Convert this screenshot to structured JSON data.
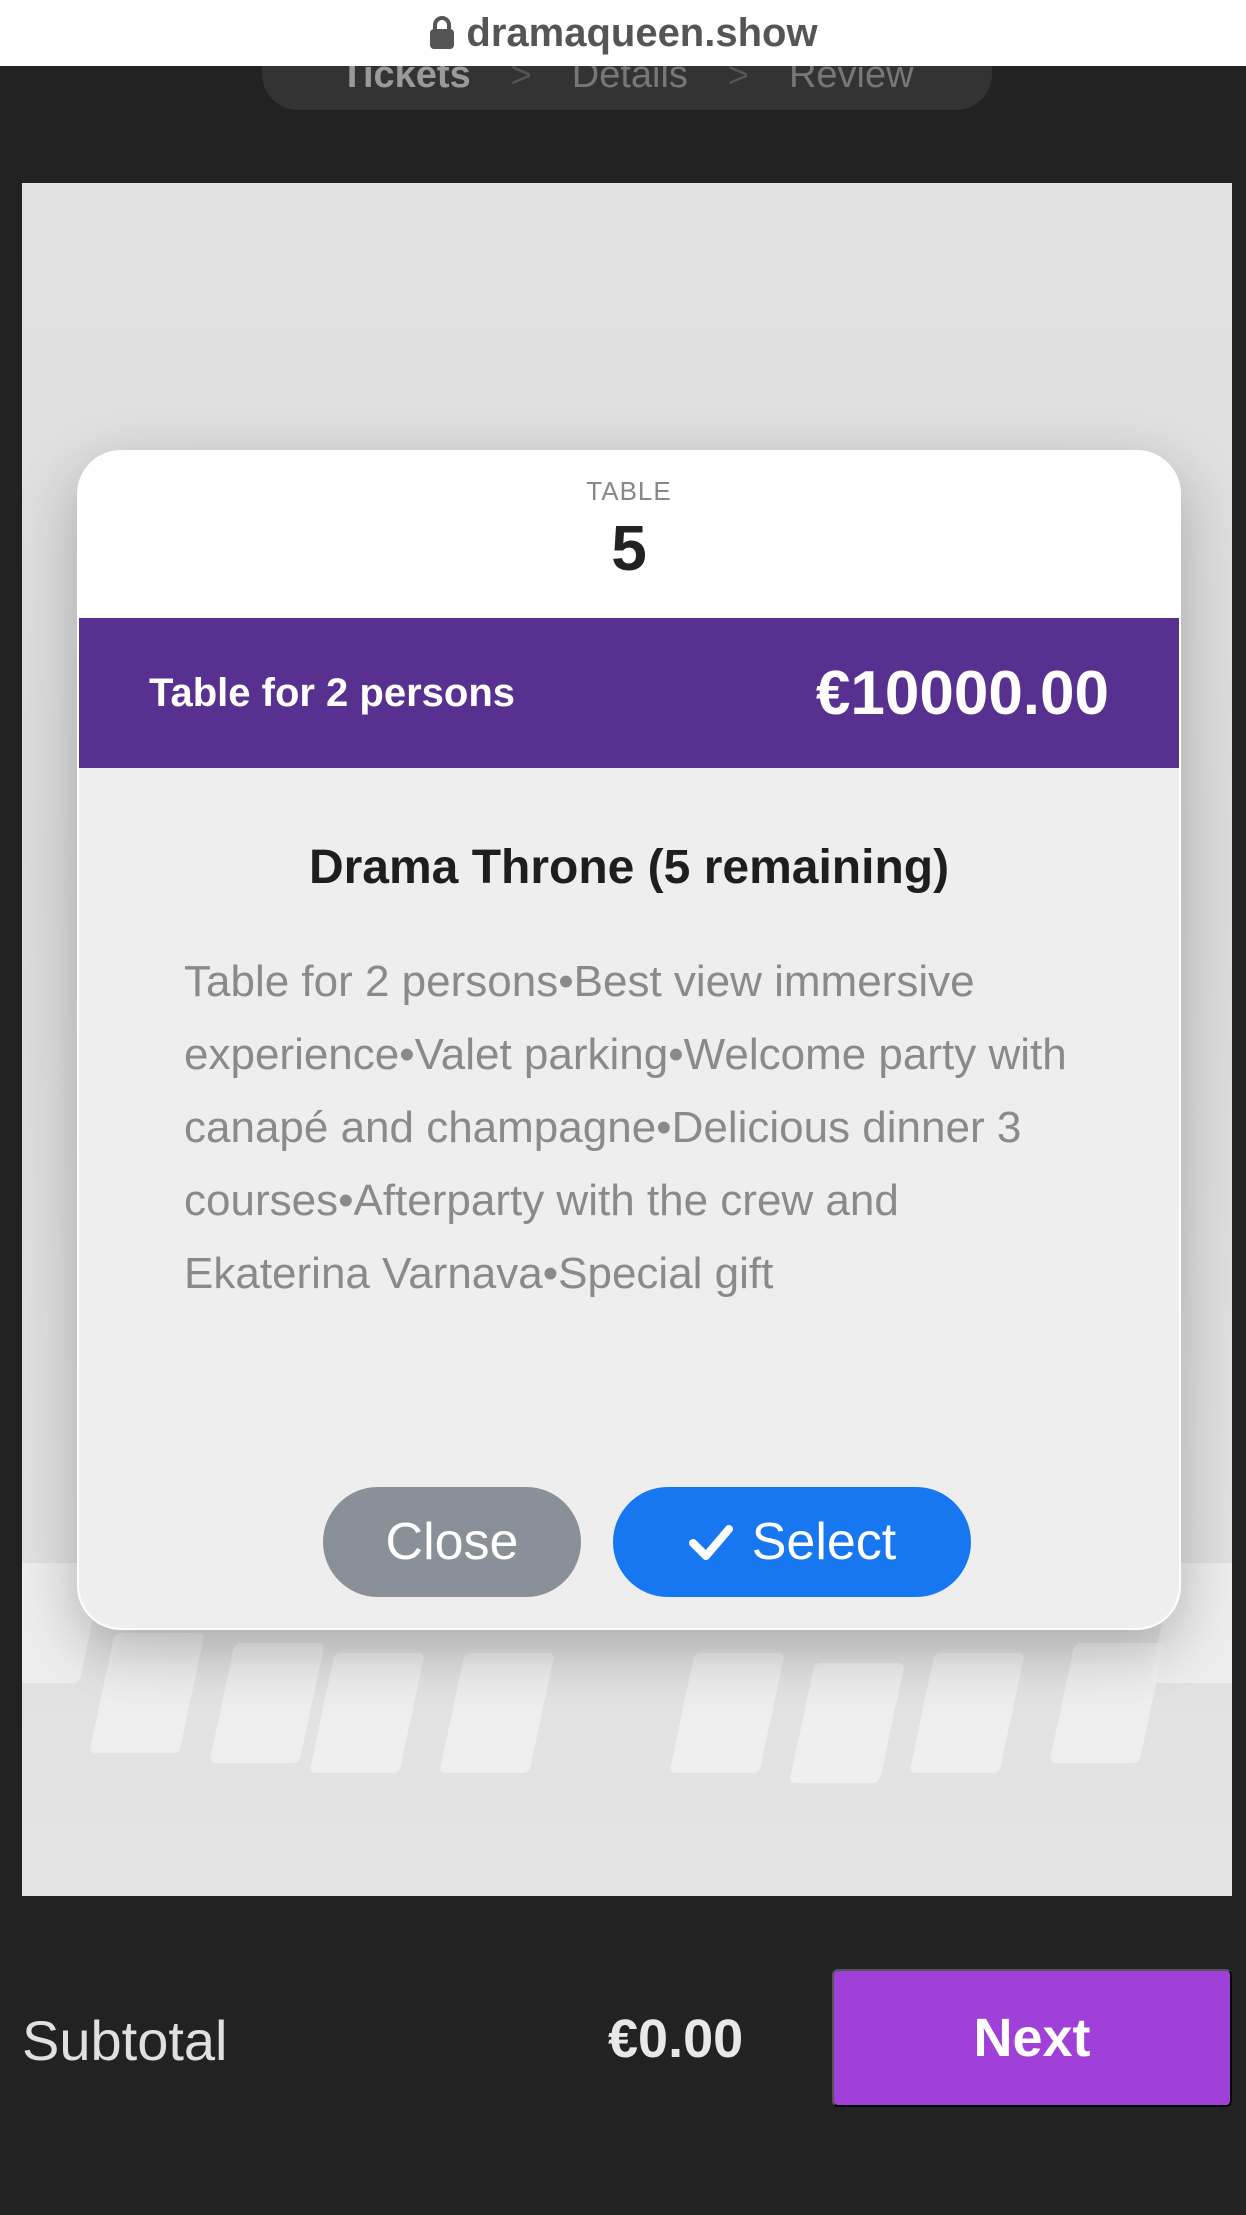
{
  "browser": {
    "url": "dramaqueen.show"
  },
  "steps": {
    "items": [
      "Tickets",
      "Details",
      "Review"
    ],
    "separator": ">"
  },
  "modal": {
    "header_label": "TABLE",
    "table_number": "5",
    "band_label": "Table for 2 persons",
    "price": "€10000.00",
    "title": "Drama Throne (5 remaining)",
    "description": "Table for 2 persons•Best view immersive experience•Valet parking•Welcome party with canapé and champagne•Delicious dinner 3 courses•Afterparty with the crew and Ekaterina Varnava•Special gift",
    "close_label": "Close",
    "select_label": "Select",
    "colors": {
      "band": "#58308f",
      "select": "#1677f0",
      "close": "#8a9098"
    }
  },
  "footer": {
    "subtotal_label": "Subtotal",
    "subtotal_value": "€0.00",
    "next_label": "Next",
    "next_color": "#a040d8"
  }
}
